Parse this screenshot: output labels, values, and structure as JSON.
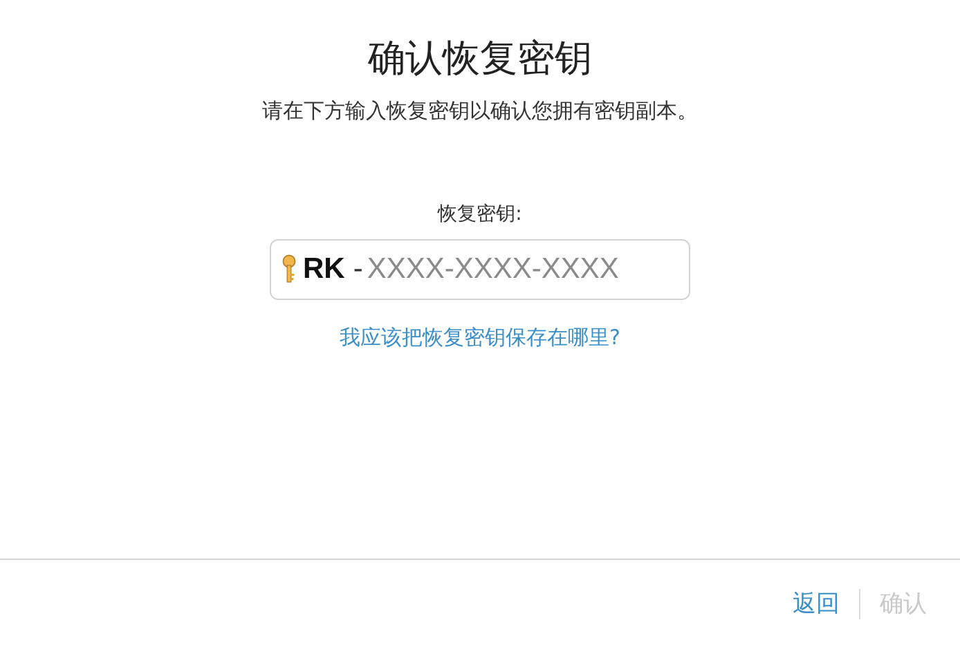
{
  "title": "确认恢复密钥",
  "subtitle": "请在下方输入恢复密钥以确认您拥有密钥副本。",
  "field": {
    "label": "恢复密钥:",
    "prefix": "RK",
    "separator": "-",
    "placeholder": "XXXX-XXXX-XXXX"
  },
  "help_link": "我应该把恢复密钥保存在哪里?",
  "buttons": [
    {
      "label": "返回",
      "disabled": false
    },
    {
      "label": "确认",
      "disabled": true
    }
  ]
}
